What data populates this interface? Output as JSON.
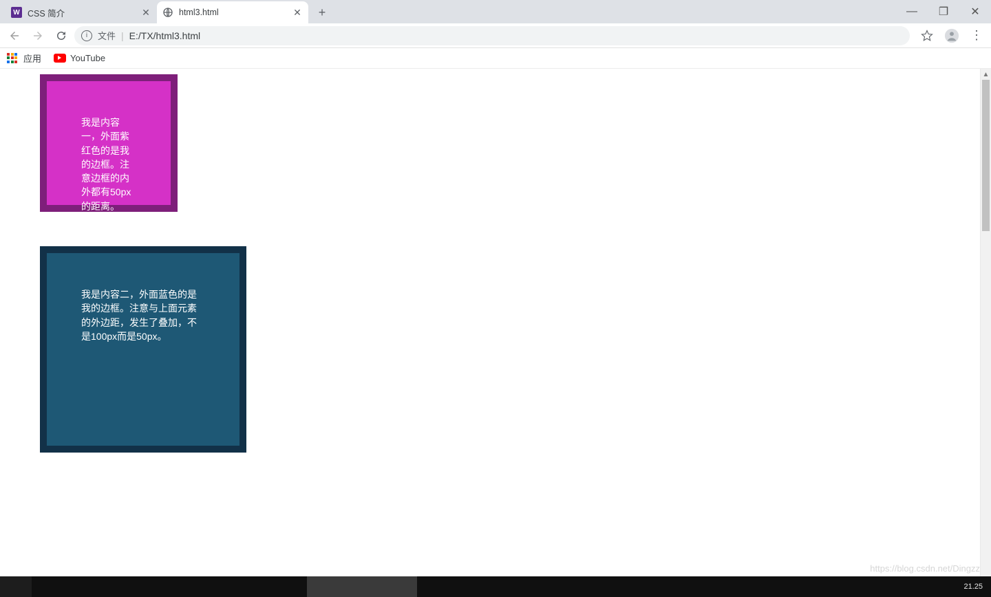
{
  "tabs": [
    {
      "title": "CSS 简介",
      "favicon_letter": "W",
      "active": false
    },
    {
      "title": "html3.html",
      "active": true
    }
  ],
  "window_controls": {
    "minimize": "—",
    "maximize": "❐",
    "close": "✕"
  },
  "newtab_glyph": "+",
  "address_bar": {
    "info_glyph": "i",
    "prefix": "文件",
    "url": "E:/TX/html3.html"
  },
  "nav": {
    "back": "←",
    "forward": "→",
    "reload": "↻"
  },
  "right": {
    "star": "☆",
    "menu": "⋮"
  },
  "bookmarks": {
    "apps_label": "应用",
    "items": [
      {
        "label": "YouTube"
      }
    ]
  },
  "page": {
    "box1_text": "我是内容一，外面紫红色的是我的边框。注意边框的内外都有50px的距离。",
    "box2_text": "我是内容二，外面蓝色的是我的边框。注意与上面元素的外边距，发生了叠加，不是100px而是50px。"
  },
  "scrollbar": {
    "up": "▲",
    "down": "▼"
  },
  "taskbar": {
    "time": "21.25"
  },
  "watermark": "https://blog.csdn.net/Dingzz"
}
